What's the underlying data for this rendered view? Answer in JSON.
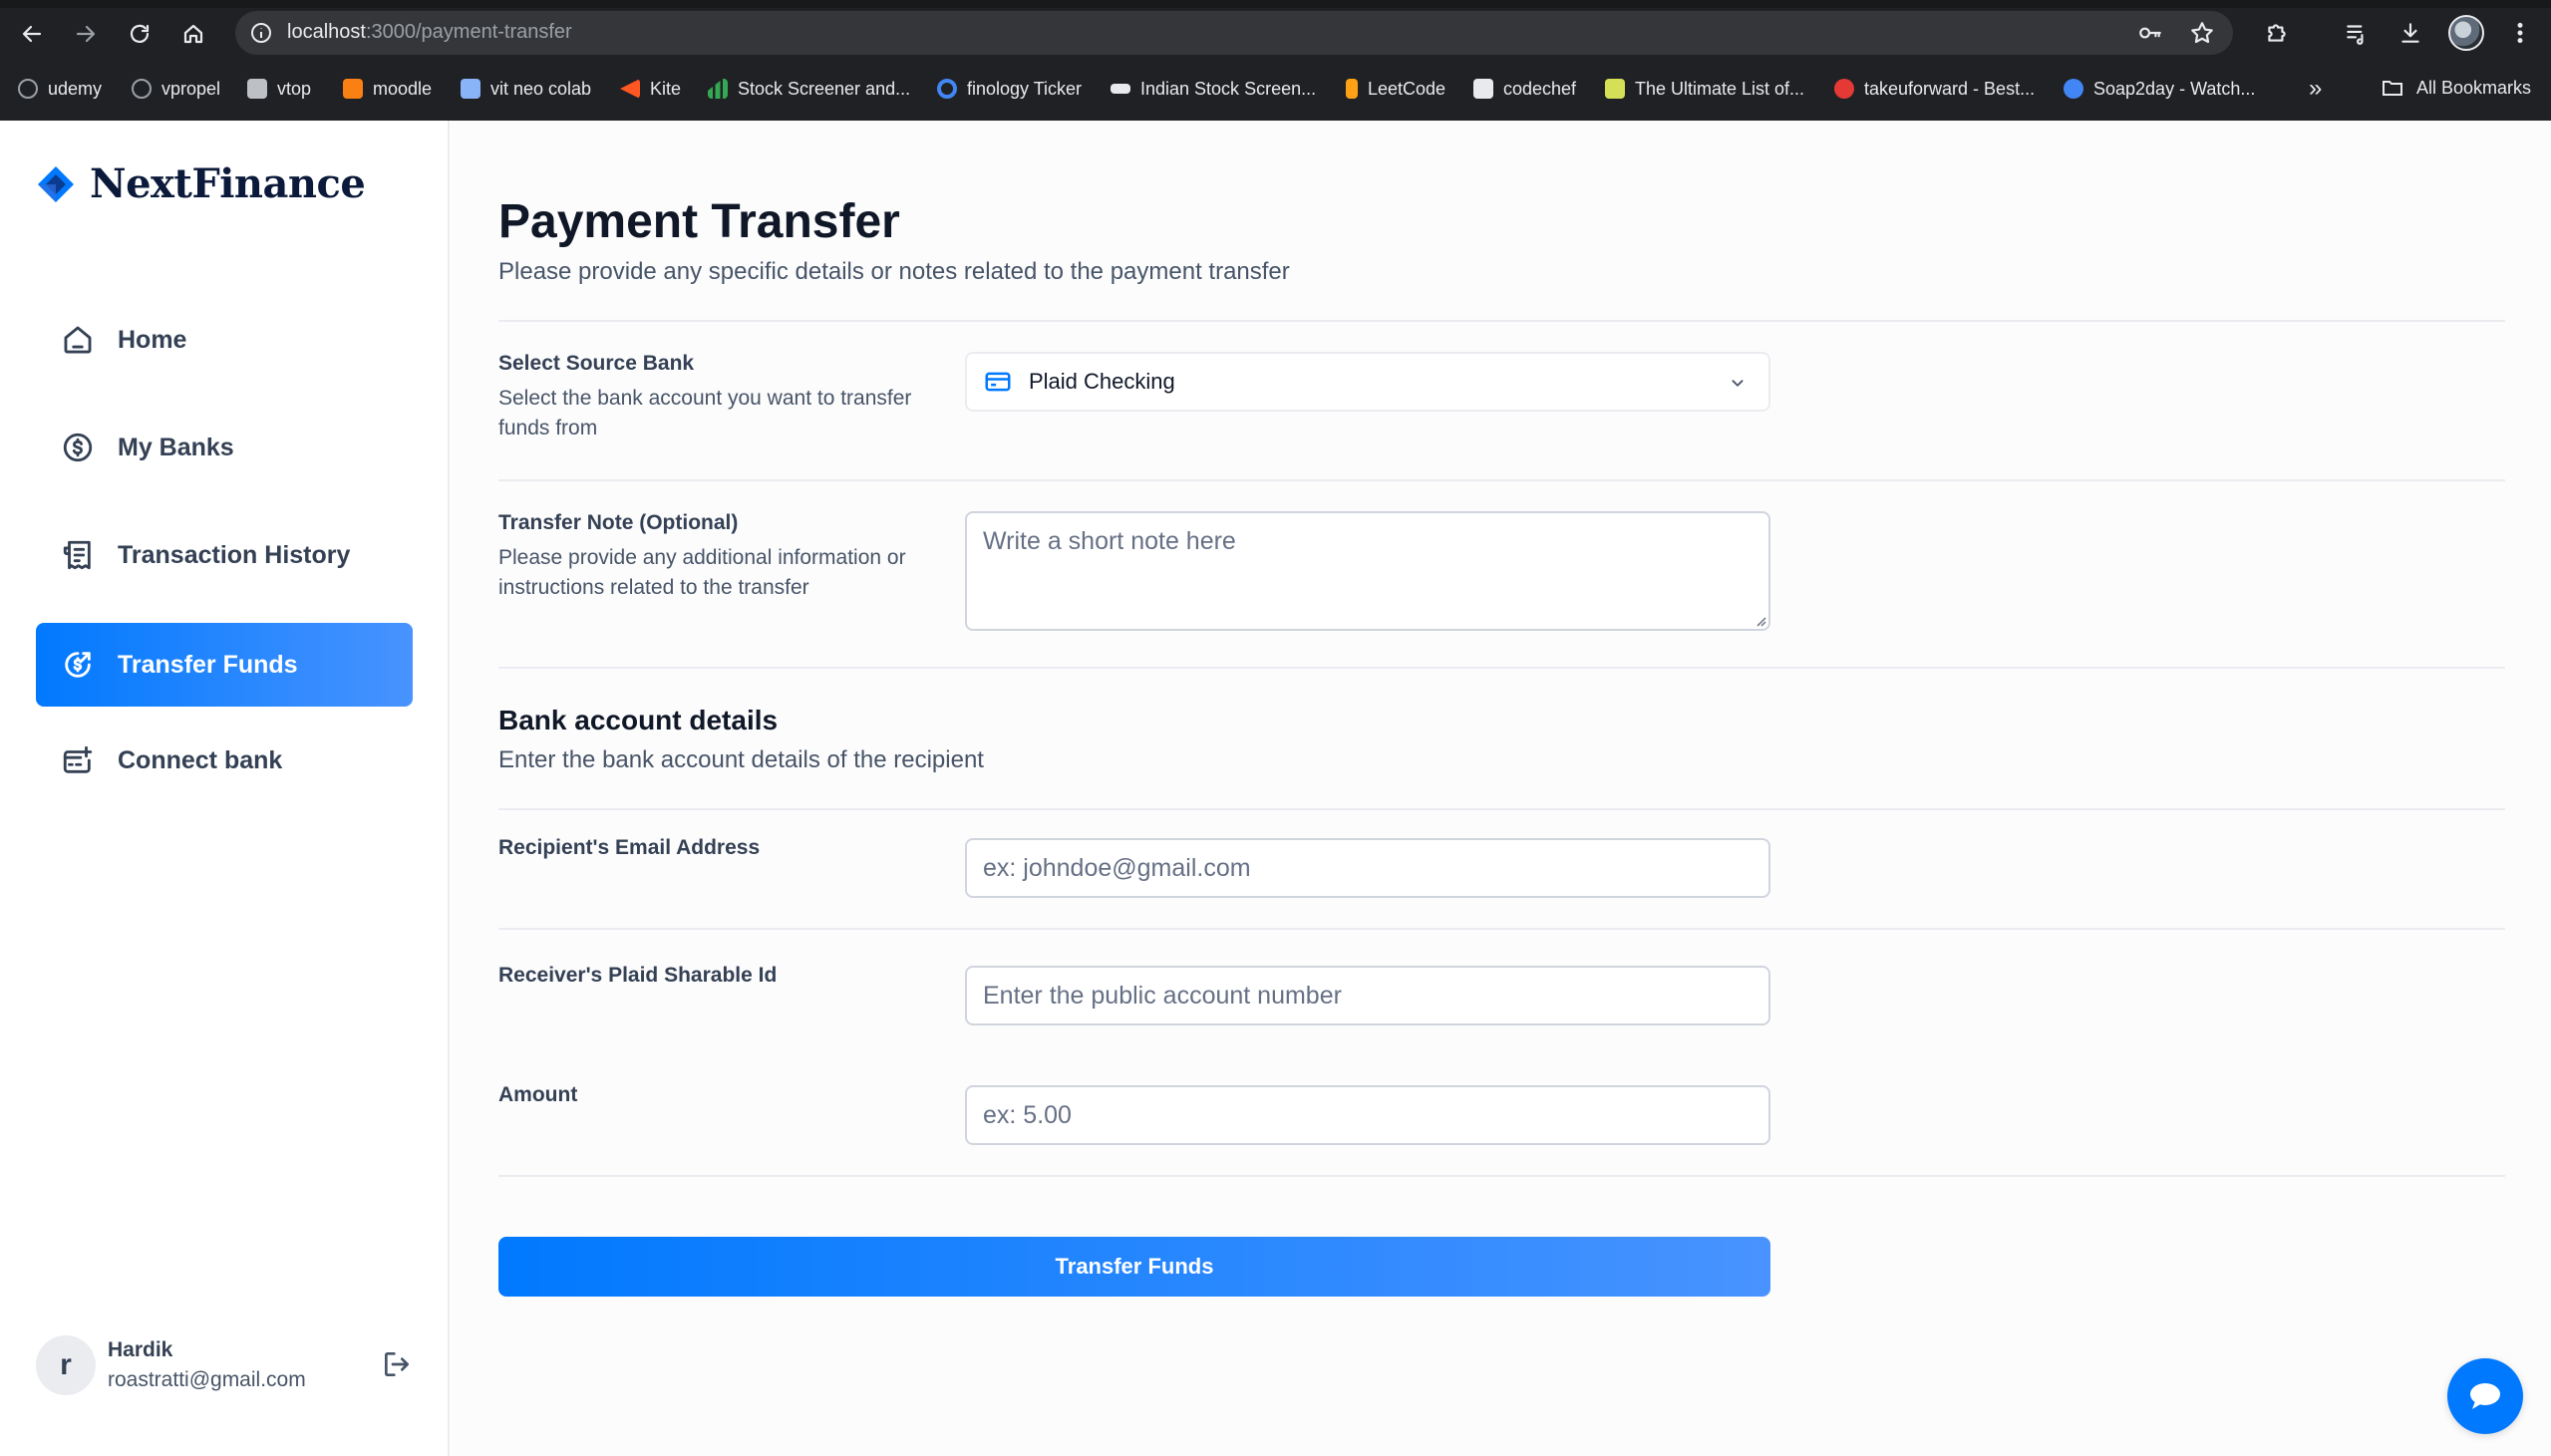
{
  "browser": {
    "url_host": "localhost",
    "url_path": ":3000/payment-transfer",
    "bookmarks": [
      {
        "label": "udemy",
        "color": "#a435f0"
      },
      {
        "label": "vpropel",
        "color": "#9aa0a6"
      },
      {
        "label": "vtop",
        "color": "#5f6368"
      },
      {
        "label": "moodle",
        "color": "#f98012"
      },
      {
        "label": "vit neo colab",
        "color": "#8ab4f8"
      },
      {
        "label": "Kite",
        "color": "#ff5722"
      },
      {
        "label": "Stock Screener and...",
        "color": "#34a853"
      },
      {
        "label": "finology Ticker",
        "color": "#4285f4"
      },
      {
        "label": "Indian Stock Screen...",
        "color": "#e8eaed"
      },
      {
        "label": "LeetCode",
        "color": "#ffa116"
      },
      {
        "label": "codechef",
        "color": "#5b4638"
      },
      {
        "label": "The Ultimate List of...",
        "color": "#d4e157"
      },
      {
        "label": "takeuforward - Best...",
        "color": "#e53935"
      },
      {
        "label": "Soap2day - Watch...",
        "color": "#4285f4"
      }
    ],
    "more_label": "»",
    "all_bookmarks_label": "All Bookmarks"
  },
  "sidebar": {
    "brand": "NextFinance",
    "items": [
      {
        "label": "Home",
        "icon": "home-icon",
        "active": false
      },
      {
        "label": "My Banks",
        "icon": "dollar-circle-icon",
        "active": false
      },
      {
        "label": "Transaction History",
        "icon": "receipt-icon",
        "active": false
      },
      {
        "label": "Transfer Funds",
        "icon": "money-send-icon",
        "active": true
      },
      {
        "label": "Connect bank",
        "icon": "connect-bank-icon",
        "active": false
      }
    ],
    "user": {
      "initial": "r",
      "name": "Hardik",
      "email": "roastratti@gmail.com"
    }
  },
  "main": {
    "title": "Payment Transfer",
    "subtitle": "Please provide any specific details or notes related to the payment transfer",
    "source_bank": {
      "label": "Select Source Bank",
      "help": "Select the bank account you want to transfer funds from",
      "value": "Plaid Checking"
    },
    "note": {
      "label": "Transfer Note (Optional)",
      "help": "Please provide any additional information or instructions related to the transfer",
      "placeholder": "Write a short note here"
    },
    "bank_details": {
      "title": "Bank account details",
      "subtitle": "Enter the bank account details of the recipient"
    },
    "email": {
      "label": "Recipient's Email Address",
      "placeholder": "ex: johndoe@gmail.com"
    },
    "sharable_id": {
      "label": "Receiver's Plaid Sharable Id",
      "placeholder": "Enter the public account number"
    },
    "amount": {
      "label": "Amount",
      "placeholder": "ex: 5.00"
    },
    "submit_label": "Transfer Funds"
  },
  "colors": {
    "accent": "#0179fe",
    "accent_light": "#4893ff"
  }
}
